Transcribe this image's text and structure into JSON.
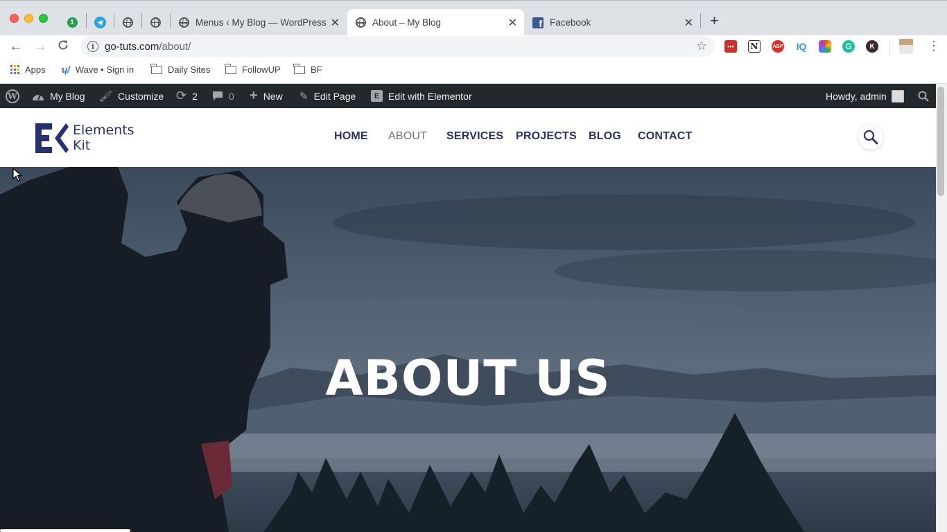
{
  "browser": {
    "tabs": [
      {
        "title": "Menus ‹ My Blog — WordPress",
        "active": false
      },
      {
        "title": "About – My Blog",
        "active": true
      },
      {
        "title": "Facebook",
        "active": false
      }
    ],
    "pinned_tab_badge": "1",
    "address": {
      "domain": "go-tuts.com",
      "path": "/about/"
    },
    "bookmarks": [
      "Apps",
      "Wave • Sign in",
      "Daily Sites",
      "FollowUP",
      "BF"
    ],
    "extensions": [
      "lastpass-icon",
      "notion-icon",
      "adblock-icon",
      "iq-icon",
      "colorpicker-icon",
      "grammarly-icon",
      "k-icon"
    ],
    "extension_labels": {
      "adblock": "ABP",
      "iq": "IQ",
      "k": "K",
      "notion": "N"
    }
  },
  "admin_bar": {
    "site": "My Blog",
    "customize": "Customize",
    "updates": "2",
    "comments": "0",
    "new": "New",
    "edit_page": "Edit Page",
    "elementor": "Edit with Elementor",
    "howdy": "Howdy, admin"
  },
  "site": {
    "logo_line1": "Elements",
    "logo_line2": "Kit",
    "menu": [
      "HOME",
      "ABOUT",
      "SERVICES",
      "PROJECTS",
      "BLOG",
      "CONTACT"
    ],
    "active_menu": "ABOUT",
    "hero_title": "ABOUT US"
  },
  "colors": {
    "brand": "#273171",
    "admin_bar": "#23282d",
    "tabstrip": "#dee1e6"
  }
}
